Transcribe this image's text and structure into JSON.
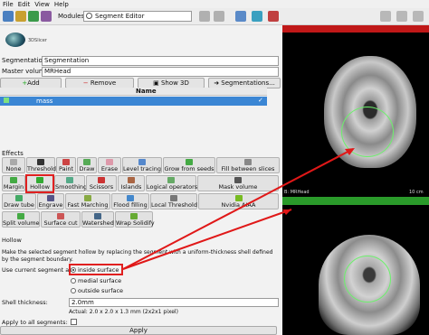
{
  "menu": [
    "File",
    "Edit",
    "View",
    "Help"
  ],
  "toolbar": {
    "modules_label": "Modules:",
    "module_value": "Segment Editor"
  },
  "logo_text": "3DSlicer",
  "segmentation": {
    "label": "Segmentation:",
    "value": "Segmentation"
  },
  "master_volume": {
    "label": "Master volume:",
    "value": "MRHead"
  },
  "actions": {
    "add": "Add",
    "remove": "Remove",
    "show3d": "Show 3D",
    "segmentations": "Segmentations..."
  },
  "table": {
    "header_name": "Name",
    "row_name": "mass"
  },
  "effects": {
    "title": "Effects",
    "row1": [
      "None",
      "Threshold",
      "Paint",
      "Draw",
      "Erase",
      "Level tracing",
      "Grow from seeds",
      "Fill between slices"
    ],
    "row2": [
      "Margin",
      "Hollow",
      "Smoothing",
      "Scissors",
      "Islands",
      "Logical operators",
      "Mask volume"
    ],
    "row3": [
      "Draw tube",
      "Engrave",
      "Fast Marching",
      "Flood filling",
      "Local Threshold",
      "Nvidia AIAA"
    ],
    "row4": [
      "Split volume",
      "Surface cut",
      "Watershed",
      "Wrap Solidify"
    ]
  },
  "hollow": {
    "section": "Hollow",
    "desc1": "Make the selected segment hollow by replacing the segment with a uniform-thickness shell defined",
    "desc2": "by the segment boundary.",
    "use_label": "Use current segment as:",
    "opt_inside": "inside surface",
    "opt_medial": "medial surface",
    "opt_outside": "outside surface",
    "shell_label": "Shell thickness:",
    "shell_value": "2.0mm",
    "actual": "Actual: 2.0 x 2.0 x 1.3 mm (2x2x1 pixel)",
    "apply_all": "Apply to all segments:",
    "apply": "Apply"
  },
  "viewer": {
    "top_label": "B: MRHead",
    "scale": "10 cm"
  },
  "colors": {
    "red": "#c01818",
    "green": "#2a9a2a",
    "selection": "#3b86d4"
  }
}
